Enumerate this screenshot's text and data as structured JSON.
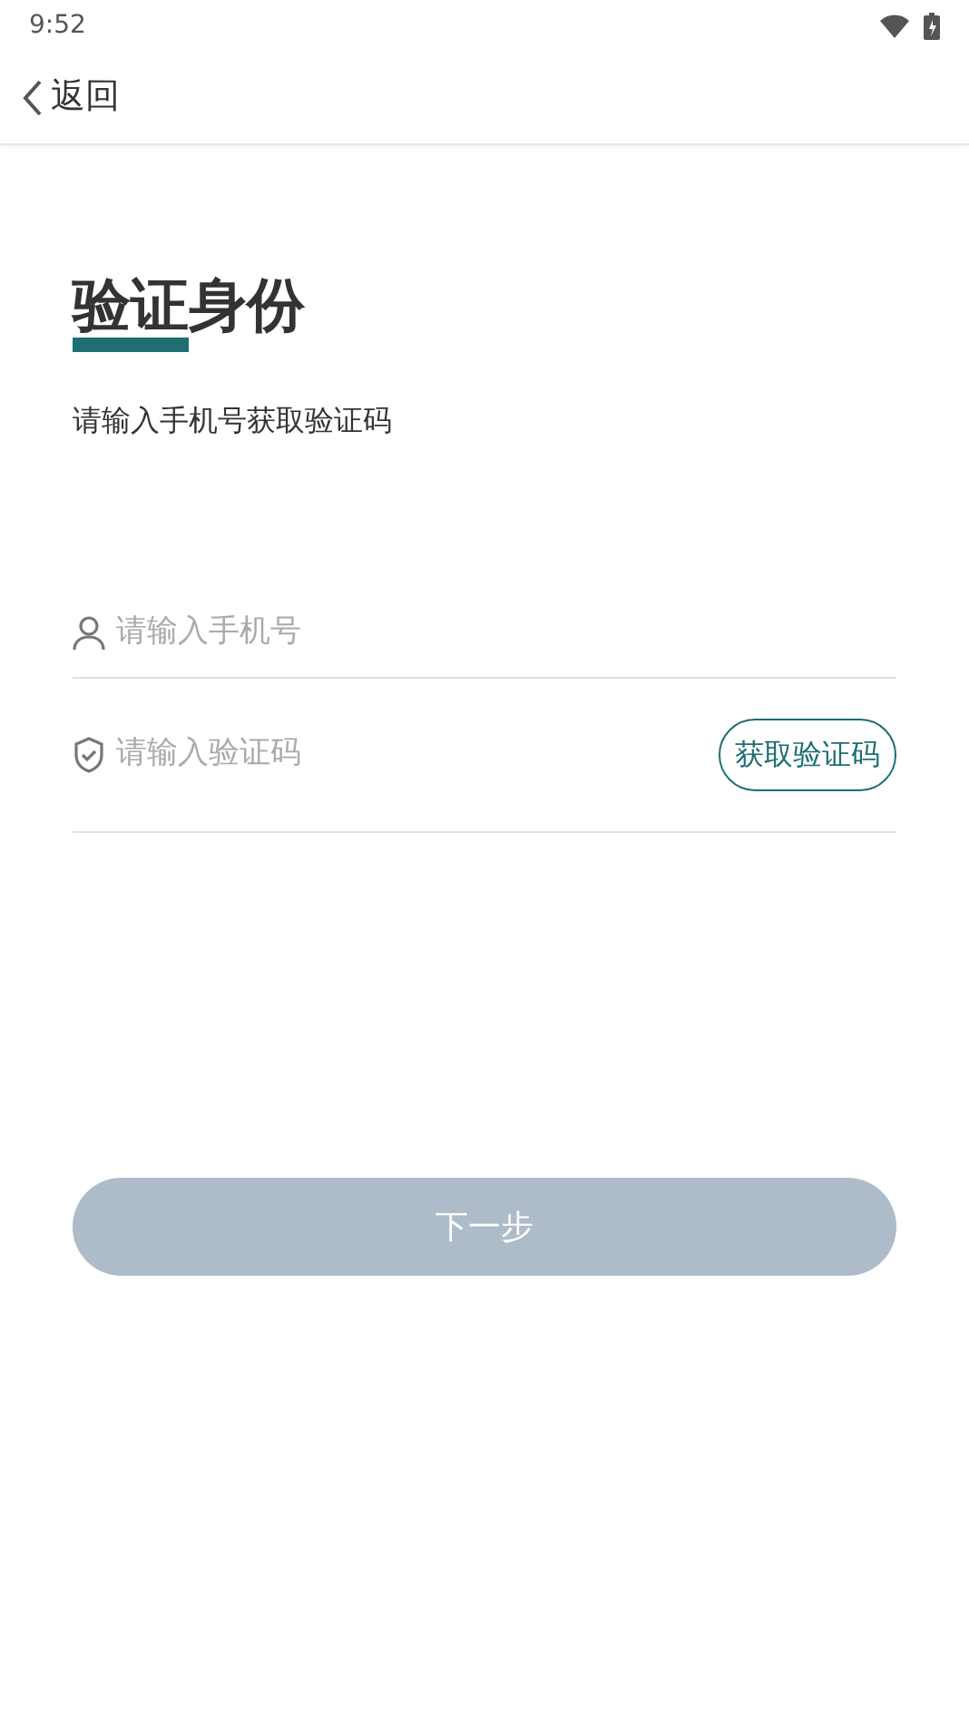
{
  "status_bar": {
    "time": "9:52"
  },
  "header": {
    "back_label": "返回"
  },
  "title": {
    "underlined": "验证",
    "rest": "身份"
  },
  "subtitle": "请输入手机号获取验证码",
  "fields": [
    {
      "kind": "phone",
      "placeholder": "请输入手机号"
    },
    {
      "kind": "code",
      "placeholder": "请输入验证码",
      "action": "获取验证码"
    }
  ],
  "next_button": {
    "label": "下一步",
    "disabled": true
  }
}
